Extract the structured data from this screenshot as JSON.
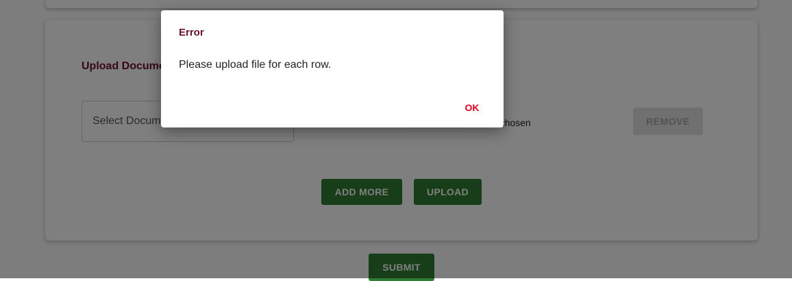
{
  "form": {
    "section_title": "Upload Documents",
    "select_placeholder": "Select Document",
    "file_status": "No file chosen",
    "remove_label": "REMOVE",
    "add_more_label": "ADD MORE",
    "upload_label": "UPLOAD",
    "submit_label": "SUBMIT"
  },
  "dialog": {
    "title": "Error",
    "message": "Please upload file for each row.",
    "ok_label": "OK"
  },
  "colors": {
    "primary_green": "#2e7d32",
    "title_maroon": "#6a0f2a",
    "ok_red": "#e0001b",
    "overlay": "rgba(0,0,0,0.5)"
  }
}
